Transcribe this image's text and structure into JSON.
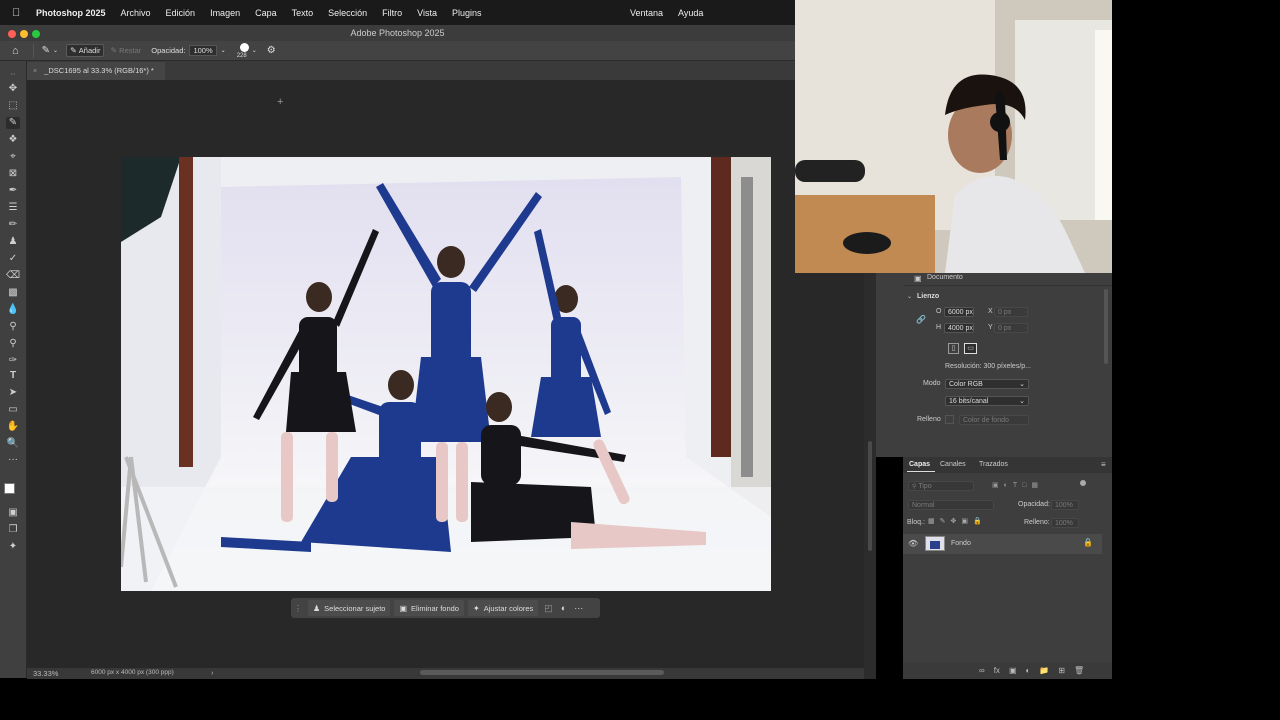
{
  "menubar": {
    "app": "Photoshop 2025",
    "items": [
      "Archivo",
      "Edición",
      "Imagen",
      "Capa",
      "Texto",
      "Selección",
      "Filtro",
      "Vista",
      "Plugins"
    ],
    "right_items": [
      "Ventana",
      "Ayuda"
    ]
  },
  "window": {
    "title": "Adobe Photoshop 2025"
  },
  "options": {
    "add_label": "Añadir",
    "subtract_label": "Restar",
    "opacity_label": "Opacidad:",
    "opacity_value": "100%",
    "brush_size": "228"
  },
  "document": {
    "tab_title": "_DSC1695 al 33.3% (RGB/16*) *"
  },
  "context_bar": {
    "select_subject": "Seleccionar sujeto",
    "remove_bg": "Eliminar fondo",
    "adjust_colors": "Ajustar colores"
  },
  "status": {
    "zoom": "33.33%",
    "doc_info": "6000 px x 4000 px (300 ppp)"
  },
  "properties": {
    "document_label": "Documento",
    "canvas_section": "Lienzo",
    "w_label": "O",
    "w_value": "6000 px",
    "h_label": "H",
    "h_value": "4000 px",
    "x_label": "X",
    "x_value": "0 px",
    "y_label": "Y",
    "y_value": "0 px",
    "resolution": "Resolución: 300 píxeles/p...",
    "mode_label": "Modo",
    "mode_value": "Color RGB",
    "depth_value": "16 bits/canal",
    "fill_label": "Relleno",
    "fill_value": "Color de fondo"
  },
  "layers": {
    "tabs": [
      "Capas",
      "Canales",
      "Trazados"
    ],
    "search_placeholder": "Tipo",
    "blend_mode": "Normal",
    "opacity_label": "Opacidad:",
    "opacity_value": "100%",
    "lock_label": "Bloq.:",
    "fill_label": "Relleno:",
    "fill_value": "100%",
    "items": [
      {
        "name": "Fondo"
      }
    ]
  },
  "colors": {
    "accent": "#2d6ad8",
    "ui_bg": "#3e3e3e",
    "canvas_bg": "#282828"
  }
}
